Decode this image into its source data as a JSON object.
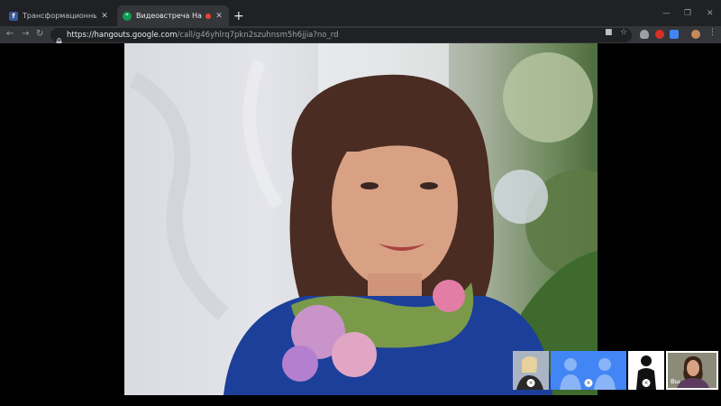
{
  "browser": {
    "tabs": [
      {
        "title": "Трансформационные игры \"Д...",
        "favicon": "facebook-icon",
        "favicon_color": "#3b5998",
        "active": false
      },
      {
        "title": "Видеовстреча Hangouts",
        "favicon": "hangouts-icon",
        "favicon_color": "#0f9d58",
        "active": true,
        "recording": true
      }
    ],
    "new_tab_label": "+",
    "url_host": "https://hangouts.google.com",
    "url_path": "/call/g46yhlrq7pkn2szuhnsm5h6jjia?no_rd"
  },
  "call": {
    "participants": [
      {
        "type": "photo",
        "muted": true
      },
      {
        "type": "avatar-group",
        "muted": true
      },
      {
        "type": "silhouette",
        "muted": true
      },
      {
        "type": "self",
        "label": "Вы"
      }
    ]
  },
  "colors": {
    "chrome_bg": "#202124",
    "toolbar_bg": "#35363a",
    "recording": "#ea4335",
    "avatar_blue": "#4285f4"
  }
}
